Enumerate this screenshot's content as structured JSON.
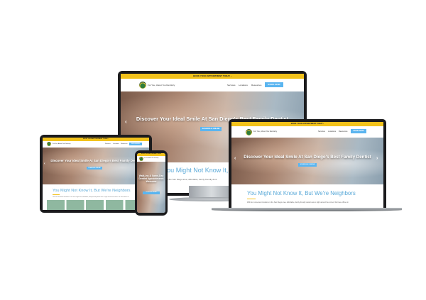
{
  "site": {
    "topbar": "BOOK YOUR APPOINTMENT TODAY",
    "topbar_arrow": "›",
    "brand": "For You, About You Dentistry",
    "nav_links": [
      "Services",
      "Locations",
      "Resources"
    ],
    "cta": "BOOK NOW",
    "hero_title": "Discover Your Ideal Smile At San Diego's Best Family Dentist",
    "hero_button": "SCHEDULE ONLINE",
    "section_title": "You Might Not Know It, But We're Neighbors",
    "paragraph": "With six convenient locations in the San Diego area, affordable, family-friendly dental care is right around the corner. We have offices in",
    "paragraph_short": "e in the San Diego area, affordable, family-friendly dent",
    "mobile_hero": "Walk-ins & Same-Day Dentist Appointments Welcome",
    "prev": "‹",
    "next": "›"
  },
  "colors": {
    "accent_yellow": "#f2c21b",
    "accent_blue": "#5ab5f0",
    "heading_blue": "#5aa9d8"
  }
}
